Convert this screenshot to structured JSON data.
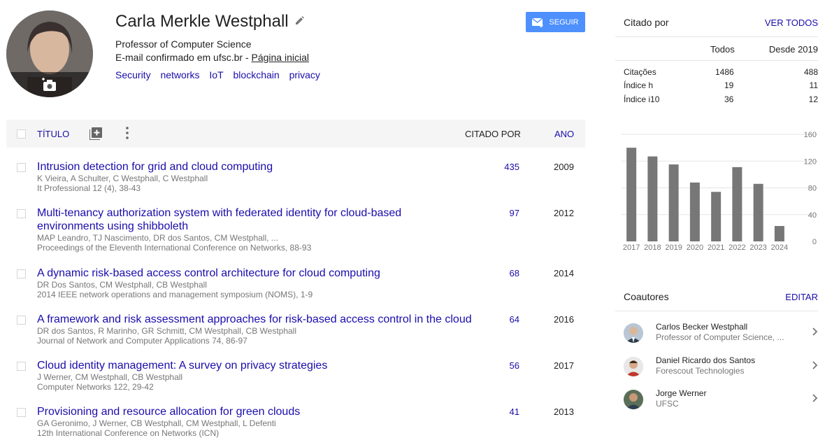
{
  "profile": {
    "name": "Carla Merkle Westphall",
    "affiliation": "Professor of Computer Science",
    "email_text": "E-mail confirmado em ufsc.br - ",
    "homepage_label": "Página inicial",
    "interests": [
      "Security",
      "networks",
      "IoT",
      "blockchain",
      "privacy"
    ],
    "follow_label": "SEGUIR"
  },
  "table": {
    "col_title": "TÍTULO",
    "col_cited": "CITADO POR",
    "col_year": "ANO",
    "rows": [
      {
        "title": "Intrusion detection for grid and cloud computing",
        "authors": "K Vieira, A Schulter, C Westphall, C Westphall",
        "venue": "It Professional 12 (4), 38-43",
        "cited": "435",
        "year": "2009"
      },
      {
        "title": "Multi-tenancy authorization system with federated identity for cloud-based environments using shibboleth",
        "authors": "MAP Leandro, TJ Nascimento, DR dos Santos, CM Westphall, ...",
        "venue": "Proceedings of the Eleventh International Conference on Networks, 88-93",
        "cited": "97",
        "year": "2012"
      },
      {
        "title": "A dynamic risk-based access control architecture for cloud computing",
        "authors": "DR Dos Santos, CM Westphall, CB Westphall",
        "venue": "2014 IEEE network operations and management symposium (NOMS), 1-9",
        "cited": "68",
        "year": "2014"
      },
      {
        "title": "A framework and risk assessment approaches for risk-based access control in the cloud",
        "authors": "DR dos Santos, R Marinho, GR Schmitt, CM Westphall, CB Westphall",
        "venue": "Journal of Network and Computer Applications 74, 86-97",
        "cited": "64",
        "year": "2016"
      },
      {
        "title": "Cloud identity management: A survey on privacy strategies",
        "authors": "J Werner, CM Westphall, CB Westphall",
        "venue": "Computer Networks 122, 29-42",
        "cited": "56",
        "year": "2017"
      },
      {
        "title": "Provisioning and resource allocation for green clouds",
        "authors": "GA Geronimo, J Werner, CB Westphall, CM Westphall, L Defenti",
        "venue": "12th International Conference on Networks (ICN)",
        "cited": "41",
        "year": "2013"
      }
    ]
  },
  "cited_by": {
    "title": "Citado por",
    "view_all": "VER TODOS",
    "col_all": "Todos",
    "col_since": "Desde 2019",
    "rows": [
      {
        "label": "Citações",
        "all": "1486",
        "since": "488"
      },
      {
        "label": "Índice h",
        "all": "19",
        "since": "11"
      },
      {
        "label": "Índice i10",
        "all": "36",
        "since": "12"
      }
    ]
  },
  "chart_data": {
    "type": "bar",
    "categories": [
      "2017",
      "2018",
      "2019",
      "2020",
      "2021",
      "2022",
      "2023",
      "2024"
    ],
    "values": [
      140,
      127,
      115,
      88,
      74,
      111,
      86,
      23
    ],
    "ylim": [
      0,
      160
    ],
    "yticks": [
      "160",
      "120",
      "80",
      "40",
      "0"
    ],
    "bar_color": "#777777",
    "grid": true
  },
  "coauthors": {
    "title": "Coautores",
    "edit_label": "EDITAR",
    "items": [
      {
        "name": "Carlos Becker Westphall",
        "affiliation": "Professor of Computer Science, ..."
      },
      {
        "name": "Daniel Ricardo dos Santos",
        "affiliation": "Forescout Technologies"
      },
      {
        "name": "Jorge Werner",
        "affiliation": "UFSC"
      }
    ]
  },
  "colors": {
    "link": "#1a0dab",
    "accent": "#4d90fe"
  }
}
